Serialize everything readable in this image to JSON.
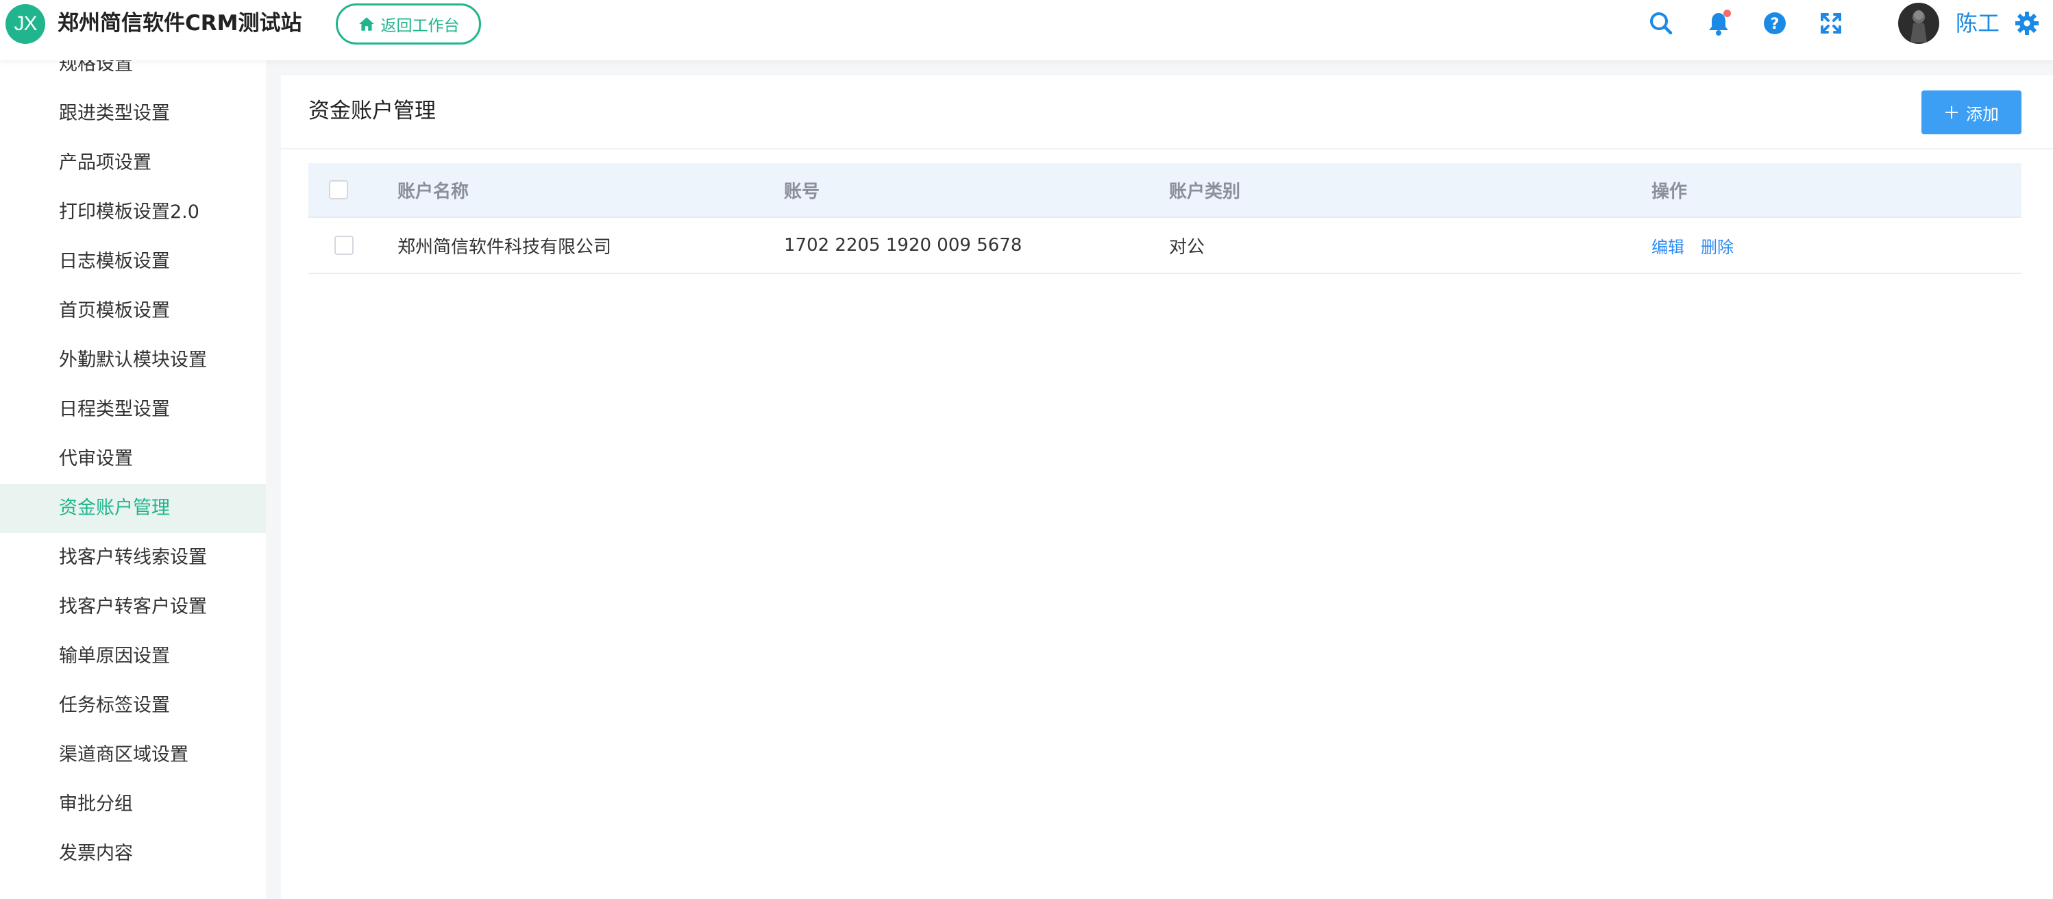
{
  "header": {
    "logo_text": "JX",
    "app_title": "郑州简信软件CRM测试站",
    "back_button": "返回工作台",
    "icons": [
      "search-icon",
      "bell-icon",
      "help-icon",
      "fullscreen-icon",
      "gear-icon"
    ],
    "username": "陈工"
  },
  "sidebar": {
    "items": [
      {
        "label": "规格设置"
      },
      {
        "label": "跟进类型设置"
      },
      {
        "label": "产品项设置"
      },
      {
        "label": "打印模板设置2.0"
      },
      {
        "label": "日志模板设置"
      },
      {
        "label": "首页模板设置"
      },
      {
        "label": "外勤默认模块设置"
      },
      {
        "label": "日程类型设置"
      },
      {
        "label": "代审设置"
      },
      {
        "label": "资金账户管理",
        "active": true
      },
      {
        "label": "找客户转线索设置"
      },
      {
        "label": "找客户转客户设置"
      },
      {
        "label": "输单原因设置"
      },
      {
        "label": "任务标签设置"
      },
      {
        "label": "渠道商区域设置"
      },
      {
        "label": "审批分组"
      },
      {
        "label": "发票内容"
      }
    ]
  },
  "main": {
    "title": "资金账户管理",
    "add_button": "添加",
    "table": {
      "columns": [
        "账户名称",
        "账号",
        "账户类别",
        "操作"
      ],
      "rows": [
        {
          "name": "郑州简信软件科技有限公司",
          "account": "1702 2205 1920 009 5678",
          "type": "对公",
          "actions": [
            "编辑",
            "删除"
          ]
        }
      ]
    }
  },
  "colors": {
    "brand": "#20b58d",
    "primary": "#3c9ff3",
    "link": "#2c8cf0",
    "active_bg": "#e9f4f1"
  }
}
